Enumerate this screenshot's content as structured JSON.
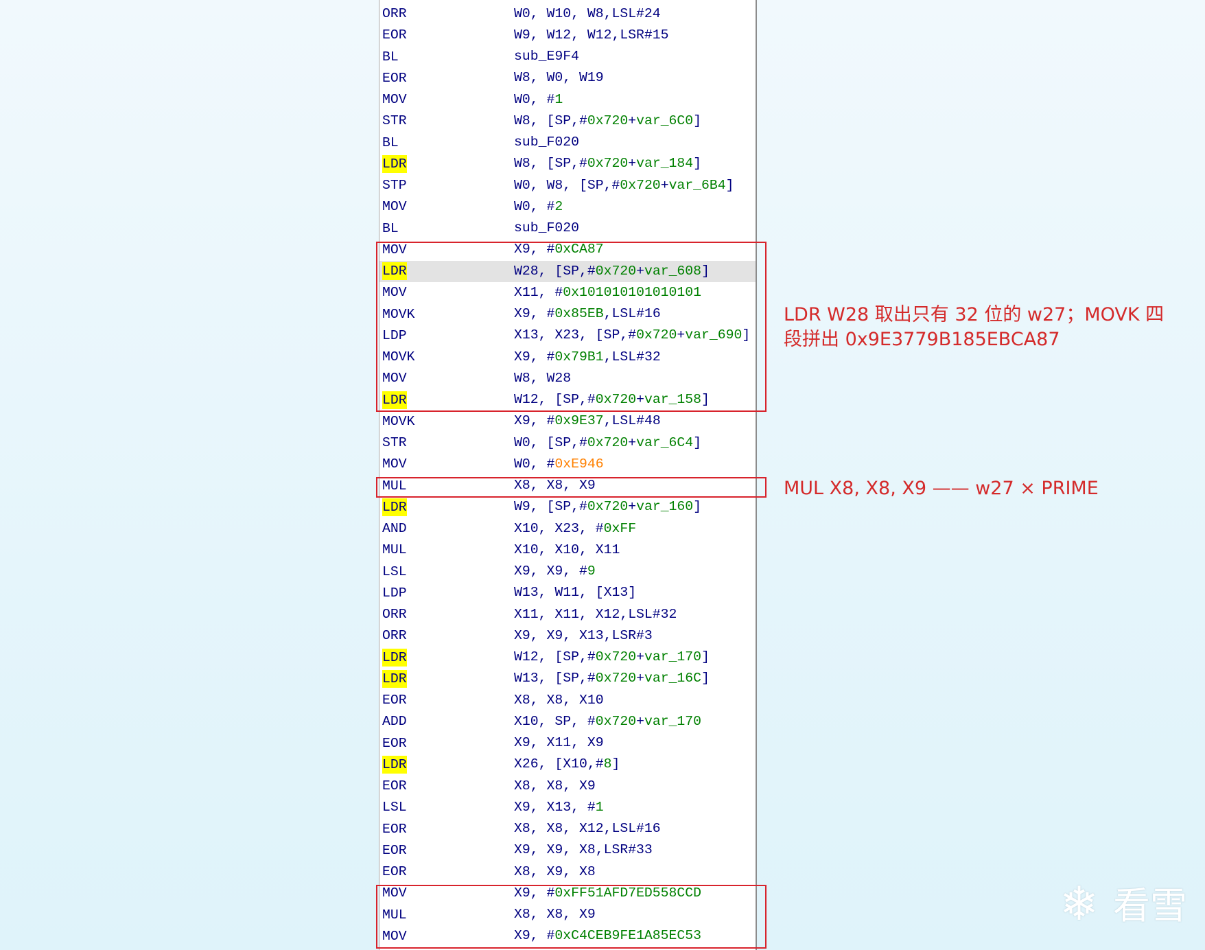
{
  "colors": {
    "register": "#000080",
    "number": "#008000",
    "orange_constant": "#FF8000",
    "search_highlight": "#FFFF00",
    "current_line": "#E3E3E3",
    "annotation_red": "#D42A2A",
    "box_red": "#D8232C"
  },
  "listing": {
    "rows": [
      {
        "mnemonic": "ORR",
        "operands": [
          [
            "W0, W10, W8,LSL#24",
            "#000080"
          ]
        ]
      },
      {
        "mnemonic": "EOR",
        "operands": [
          [
            "W9, W12, W12,LSR#15",
            "#000080"
          ]
        ]
      },
      {
        "mnemonic": "BL",
        "operands": [
          [
            "sub_E9F4",
            "#000080"
          ]
        ]
      },
      {
        "mnemonic": "EOR",
        "operands": [
          [
            "W8, W0, W19",
            "#000080"
          ]
        ]
      },
      {
        "mnemonic": "MOV",
        "operands": [
          [
            "W0, #",
            "#000080"
          ],
          [
            "1",
            "#008000"
          ]
        ]
      },
      {
        "mnemonic": "STR",
        "operands": [
          [
            "W8, [SP,#",
            "#000080"
          ],
          [
            "0x720",
            "#008000"
          ],
          [
            "+",
            "#000080"
          ],
          [
            "var_6C0",
            "#008000"
          ],
          [
            "]",
            "#000080"
          ]
        ]
      },
      {
        "mnemonic": "BL",
        "operands": [
          [
            "sub_F020",
            "#000080"
          ]
        ]
      },
      {
        "mnemonic": "LDR",
        "highlight": true,
        "operands": [
          [
            "W8, [SP,#",
            "#000080"
          ],
          [
            "0x720",
            "#008000"
          ],
          [
            "+",
            "#000080"
          ],
          [
            "var_184",
            "#008000"
          ],
          [
            "]",
            "#000080"
          ]
        ]
      },
      {
        "mnemonic": "STP",
        "operands": [
          [
            "W0, W8, [SP,#",
            "#000080"
          ],
          [
            "0x720",
            "#008000"
          ],
          [
            "+",
            "#000080"
          ],
          [
            "var_6B4",
            "#008000"
          ],
          [
            "]",
            "#000080"
          ]
        ]
      },
      {
        "mnemonic": "MOV",
        "operands": [
          [
            "W0, #",
            "#000080"
          ],
          [
            "2",
            "#008000"
          ]
        ]
      },
      {
        "mnemonic": "BL",
        "operands": [
          [
            "sub_F020",
            "#000080"
          ]
        ]
      },
      {
        "mnemonic": "MOV",
        "operands": [
          [
            "X9, #",
            "#000080"
          ],
          [
            "0xCA87",
            "#008000"
          ]
        ]
      },
      {
        "mnemonic": "LDR",
        "highlight": true,
        "current": true,
        "operands": [
          [
            "W28, [SP,#",
            "#000080"
          ],
          [
            "0x720",
            "#008000"
          ],
          [
            "+",
            "#000080"
          ],
          [
            "var_608",
            "#008000"
          ],
          [
            "]",
            "#000080"
          ]
        ]
      },
      {
        "mnemonic": "MOV",
        "operands": [
          [
            "X11, #",
            "#000080"
          ],
          [
            "0x101010101010101",
            "#008000"
          ]
        ]
      },
      {
        "mnemonic": "MOVK",
        "operands": [
          [
            "X9, #",
            "#000080"
          ],
          [
            "0x85EB",
            "#008000"
          ],
          [
            ",LSL#16",
            "#000080"
          ]
        ]
      },
      {
        "mnemonic": "LDP",
        "operands": [
          [
            "X13, X23, [SP,#",
            "#000080"
          ],
          [
            "0x720",
            "#008000"
          ],
          [
            "+",
            "#000080"
          ],
          [
            "var_690",
            "#008000"
          ],
          [
            "]",
            "#000080"
          ]
        ]
      },
      {
        "mnemonic": "MOVK",
        "operands": [
          [
            "X9, #",
            "#000080"
          ],
          [
            "0x79B1",
            "#008000"
          ],
          [
            ",LSL#32",
            "#000080"
          ]
        ]
      },
      {
        "mnemonic": "MOV",
        "operands": [
          [
            "W8, W28",
            "#000080"
          ]
        ]
      },
      {
        "mnemonic": "LDR",
        "highlight": true,
        "operands": [
          [
            "W12, [SP,#",
            "#000080"
          ],
          [
            "0x720",
            "#008000"
          ],
          [
            "+",
            "#000080"
          ],
          [
            "var_158",
            "#008000"
          ],
          [
            "]",
            "#000080"
          ]
        ]
      },
      {
        "mnemonic": "MOVK",
        "operands": [
          [
            "X9, #",
            "#000080"
          ],
          [
            "0x9E37",
            "#008000"
          ],
          [
            ",LSL#48",
            "#000080"
          ]
        ]
      },
      {
        "mnemonic": "STR",
        "operands": [
          [
            "W0, [SP,#",
            "#000080"
          ],
          [
            "0x720",
            "#008000"
          ],
          [
            "+",
            "#000080"
          ],
          [
            "var_6C4",
            "#008000"
          ],
          [
            "]",
            "#000080"
          ]
        ]
      },
      {
        "mnemonic": "MOV",
        "operands": [
          [
            "W0, #",
            "#000080"
          ],
          [
            "0xE946",
            "#FF8000"
          ]
        ]
      },
      {
        "mnemonic": "MUL",
        "operands": [
          [
            "X8, X8, X9",
            "#000080"
          ]
        ]
      },
      {
        "mnemonic": "LDR",
        "highlight": true,
        "operands": [
          [
            "W9, [SP,#",
            "#000080"
          ],
          [
            "0x720",
            "#008000"
          ],
          [
            "+",
            "#000080"
          ],
          [
            "var_160",
            "#008000"
          ],
          [
            "]",
            "#000080"
          ]
        ]
      },
      {
        "mnemonic": "AND",
        "operands": [
          [
            "X10, X23, #",
            "#000080"
          ],
          [
            "0xFF",
            "#008000"
          ]
        ]
      },
      {
        "mnemonic": "MUL",
        "operands": [
          [
            "X10, X10, X11",
            "#000080"
          ]
        ]
      },
      {
        "mnemonic": "LSL",
        "operands": [
          [
            "X9, X9, #",
            "#000080"
          ],
          [
            "9",
            "#008000"
          ]
        ]
      },
      {
        "mnemonic": "LDP",
        "operands": [
          [
            "W13, W11, [X13]",
            "#000080"
          ]
        ]
      },
      {
        "mnemonic": "ORR",
        "operands": [
          [
            "X11, X11, X12,LSL#32",
            "#000080"
          ]
        ]
      },
      {
        "mnemonic": "ORR",
        "operands": [
          [
            "X9, X9, X13,LSR#3",
            "#000080"
          ]
        ]
      },
      {
        "mnemonic": "LDR",
        "highlight": true,
        "operands": [
          [
            "W12, [SP,#",
            "#000080"
          ],
          [
            "0x720",
            "#008000"
          ],
          [
            "+",
            "#000080"
          ],
          [
            "var_170",
            "#008000"
          ],
          [
            "]",
            "#000080"
          ]
        ]
      },
      {
        "mnemonic": "LDR",
        "highlight": true,
        "operands": [
          [
            "W13, [SP,#",
            "#000080"
          ],
          [
            "0x720",
            "#008000"
          ],
          [
            "+",
            "#000080"
          ],
          [
            "var_16C",
            "#008000"
          ],
          [
            "]",
            "#000080"
          ]
        ]
      },
      {
        "mnemonic": "EOR",
        "operands": [
          [
            "X8, X8, X10",
            "#000080"
          ]
        ]
      },
      {
        "mnemonic": "ADD",
        "operands": [
          [
            "X10, SP, #",
            "#000080"
          ],
          [
            "0x720",
            "#008000"
          ],
          [
            "+",
            "#000080"
          ],
          [
            "var_170",
            "#008000"
          ]
        ]
      },
      {
        "mnemonic": "EOR",
        "operands": [
          [
            "X9, X11, X9",
            "#000080"
          ]
        ]
      },
      {
        "mnemonic": "LDR",
        "highlight": true,
        "operands": [
          [
            "X26, [X10,#",
            "#000080"
          ],
          [
            "8",
            "#008000"
          ],
          [
            "]",
            "#000080"
          ]
        ]
      },
      {
        "mnemonic": "EOR",
        "operands": [
          [
            "X8, X8, X9",
            "#000080"
          ]
        ]
      },
      {
        "mnemonic": "LSL",
        "operands": [
          [
            "X9, X13, #",
            "#000080"
          ],
          [
            "1",
            "#008000"
          ]
        ]
      },
      {
        "mnemonic": "EOR",
        "operands": [
          [
            "X8, X8, X12,LSL#16",
            "#000080"
          ]
        ]
      },
      {
        "mnemonic": "EOR",
        "operands": [
          [
            "X9, X9, X8,LSR#33",
            "#000080"
          ]
        ]
      },
      {
        "mnemonic": "EOR",
        "operands": [
          [
            "X8, X9, X8",
            "#000080"
          ]
        ]
      },
      {
        "mnemonic": "MOV",
        "operands": [
          [
            "X9, #",
            "#000080"
          ],
          [
            "0xFF51AFD7ED558CCD",
            "#008000"
          ]
        ]
      },
      {
        "mnemonic": "MUL",
        "operands": [
          [
            "X8, X8, X9",
            "#000080"
          ]
        ]
      },
      {
        "mnemonic": "MOV",
        "operands": [
          [
            "X9, #",
            "#000080"
          ],
          [
            "0xC4CEB9FE1A85EC53",
            "#008000"
          ]
        ]
      }
    ]
  },
  "annotations": {
    "constant_note": {
      "line1": "LDR W28 取出只有 32 位的 w27；MOVK 四",
      "line2": "段拼出 0x9E3779B185EBCA87"
    },
    "mul_note": "MUL X8, X8, X9 —— w27 × PRIME"
  },
  "watermark": {
    "icon": "snowflake-icon",
    "logo_text": "看雪"
  }
}
